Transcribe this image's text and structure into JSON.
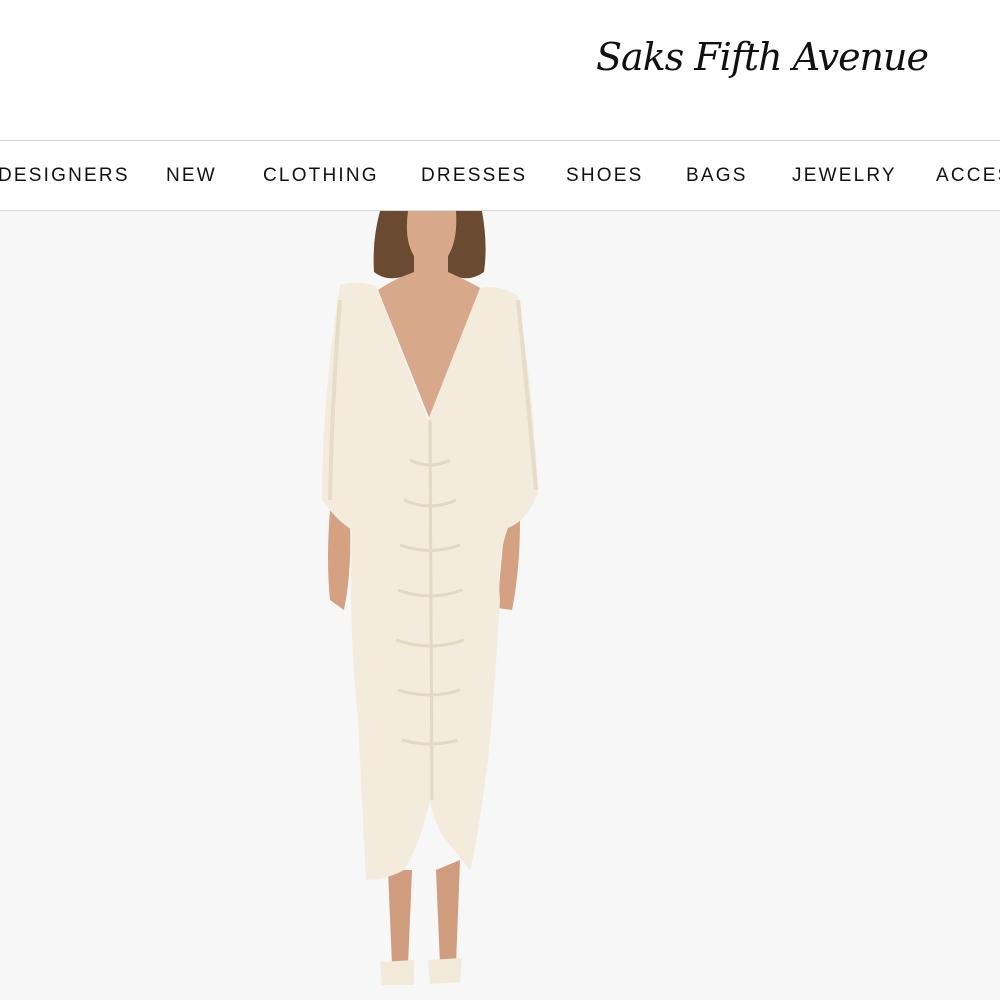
{
  "brand": {
    "logo_text": "Saks Fifth Avenue"
  },
  "nav": {
    "items": [
      {
        "label": "DESIGNERS"
      },
      {
        "label": "NEW"
      },
      {
        "label": "CLOTHING"
      },
      {
        "label": "DRESSES"
      },
      {
        "label": "SHOES"
      },
      {
        "label": "BAGS"
      },
      {
        "label": "JEWELRY"
      },
      {
        "label": "ACCES"
      }
    ]
  },
  "colors": {
    "background": "#f7f7f7",
    "header": "#ffffff",
    "dress": "#f3ecdd",
    "text": "#111111"
  }
}
